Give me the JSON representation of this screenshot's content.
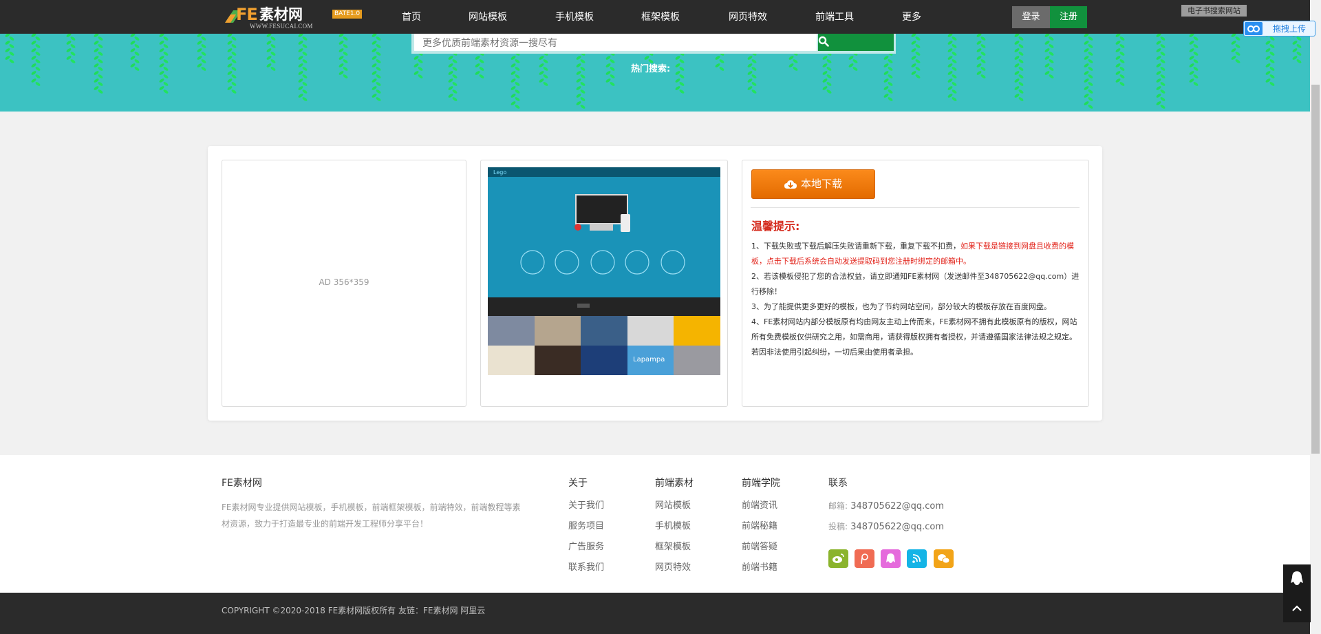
{
  "header": {
    "logo": {
      "fe": "FE",
      "name": "素材网",
      "badge": "BATE1.0",
      "url": "WWW.FESUCAI.COM"
    },
    "nav": [
      "首页",
      "网站模板",
      "手机模板",
      "框架模板",
      "网页特效",
      "前端工具",
      "更多"
    ],
    "login": "登录",
    "register": "注册",
    "search_engine_tag": "电子书搜索网站",
    "drag_upload": "拖拽上传"
  },
  "banner": {
    "search_placeholder": "更多优质前端素材资源一搜尽有",
    "hot_search": "热门搜索:"
  },
  "main": {
    "ad_text": "AD 356*359",
    "preview": {
      "logo_text": "Lego",
      "strip_text": "Lapampa"
    },
    "download_button": "本地下载",
    "tip_title": "温馨提示:",
    "tips": {
      "t1_a": "1、下载失败或下载后解压失败请重新下载，重复下载不扣费，",
      "t1_b": "如果下载是链接到网盘且收费的模板，点击下载后系统会自动发送提取码到您注册时绑定的邮箱中。",
      "t2": "2、若该模板侵犯了您的合法权益，请立即通知FE素材网（发送邮件至348705622@qq.com）进行移除！",
      "t3": "3、为了能提供更多更好的模板，也为了节约网站空间，部分较大的模板存放在百度网盘。",
      "t4": "4、FE素材网站内部分模板原有均由网友主动上传而来，FE素材网不拥有此模板原有的版权，网站所有免费模板仅供研究之用，如需商用，请获得版权拥有者授权，并请遵循国家法律法规之规定。若因非法使用引起纠纷，一切后果由使用者承担。"
    }
  },
  "footer": {
    "brand": "FE素材网",
    "desc": "FE素材网专业提供网站模板，手机模板，前端框架模板，前端特效，前端教程等素材资源，致力于打造最专业的前端开发工程师分享平台！",
    "columns": [
      {
        "title": "关于",
        "links": [
          "关于我们",
          "服务项目",
          "广告服务",
          "联系我们"
        ]
      },
      {
        "title": "前端素材",
        "links": [
          "网站模板",
          "手机模板",
          "框架模板",
          "网页特效"
        ]
      },
      {
        "title": "前端学院",
        "links": [
          "前端资讯",
          "前端秘籍",
          "前端答疑",
          "前端书籍"
        ]
      }
    ],
    "contact": {
      "title": "联系",
      "email_label": "邮箱:",
      "email": "348705622@qq.com",
      "submit_label": "投稿:",
      "submit": "348705622@qq.com"
    },
    "social_colors": [
      "#8bb42d",
      "#f06b53",
      "#e56bdc",
      "#14b4e6",
      "#f2a418"
    ],
    "copyright": "COPYRIGHT ©2020-2018 FE素材网版权所有 友链：FE素材网 阿里云"
  },
  "colors": {
    "header_bg": "#2b2b2b",
    "banner_bg": "#3cc2c2",
    "brand_green": "#11913d",
    "download_orange": "#f07e0e",
    "tip_red": "#d52b1e"
  }
}
